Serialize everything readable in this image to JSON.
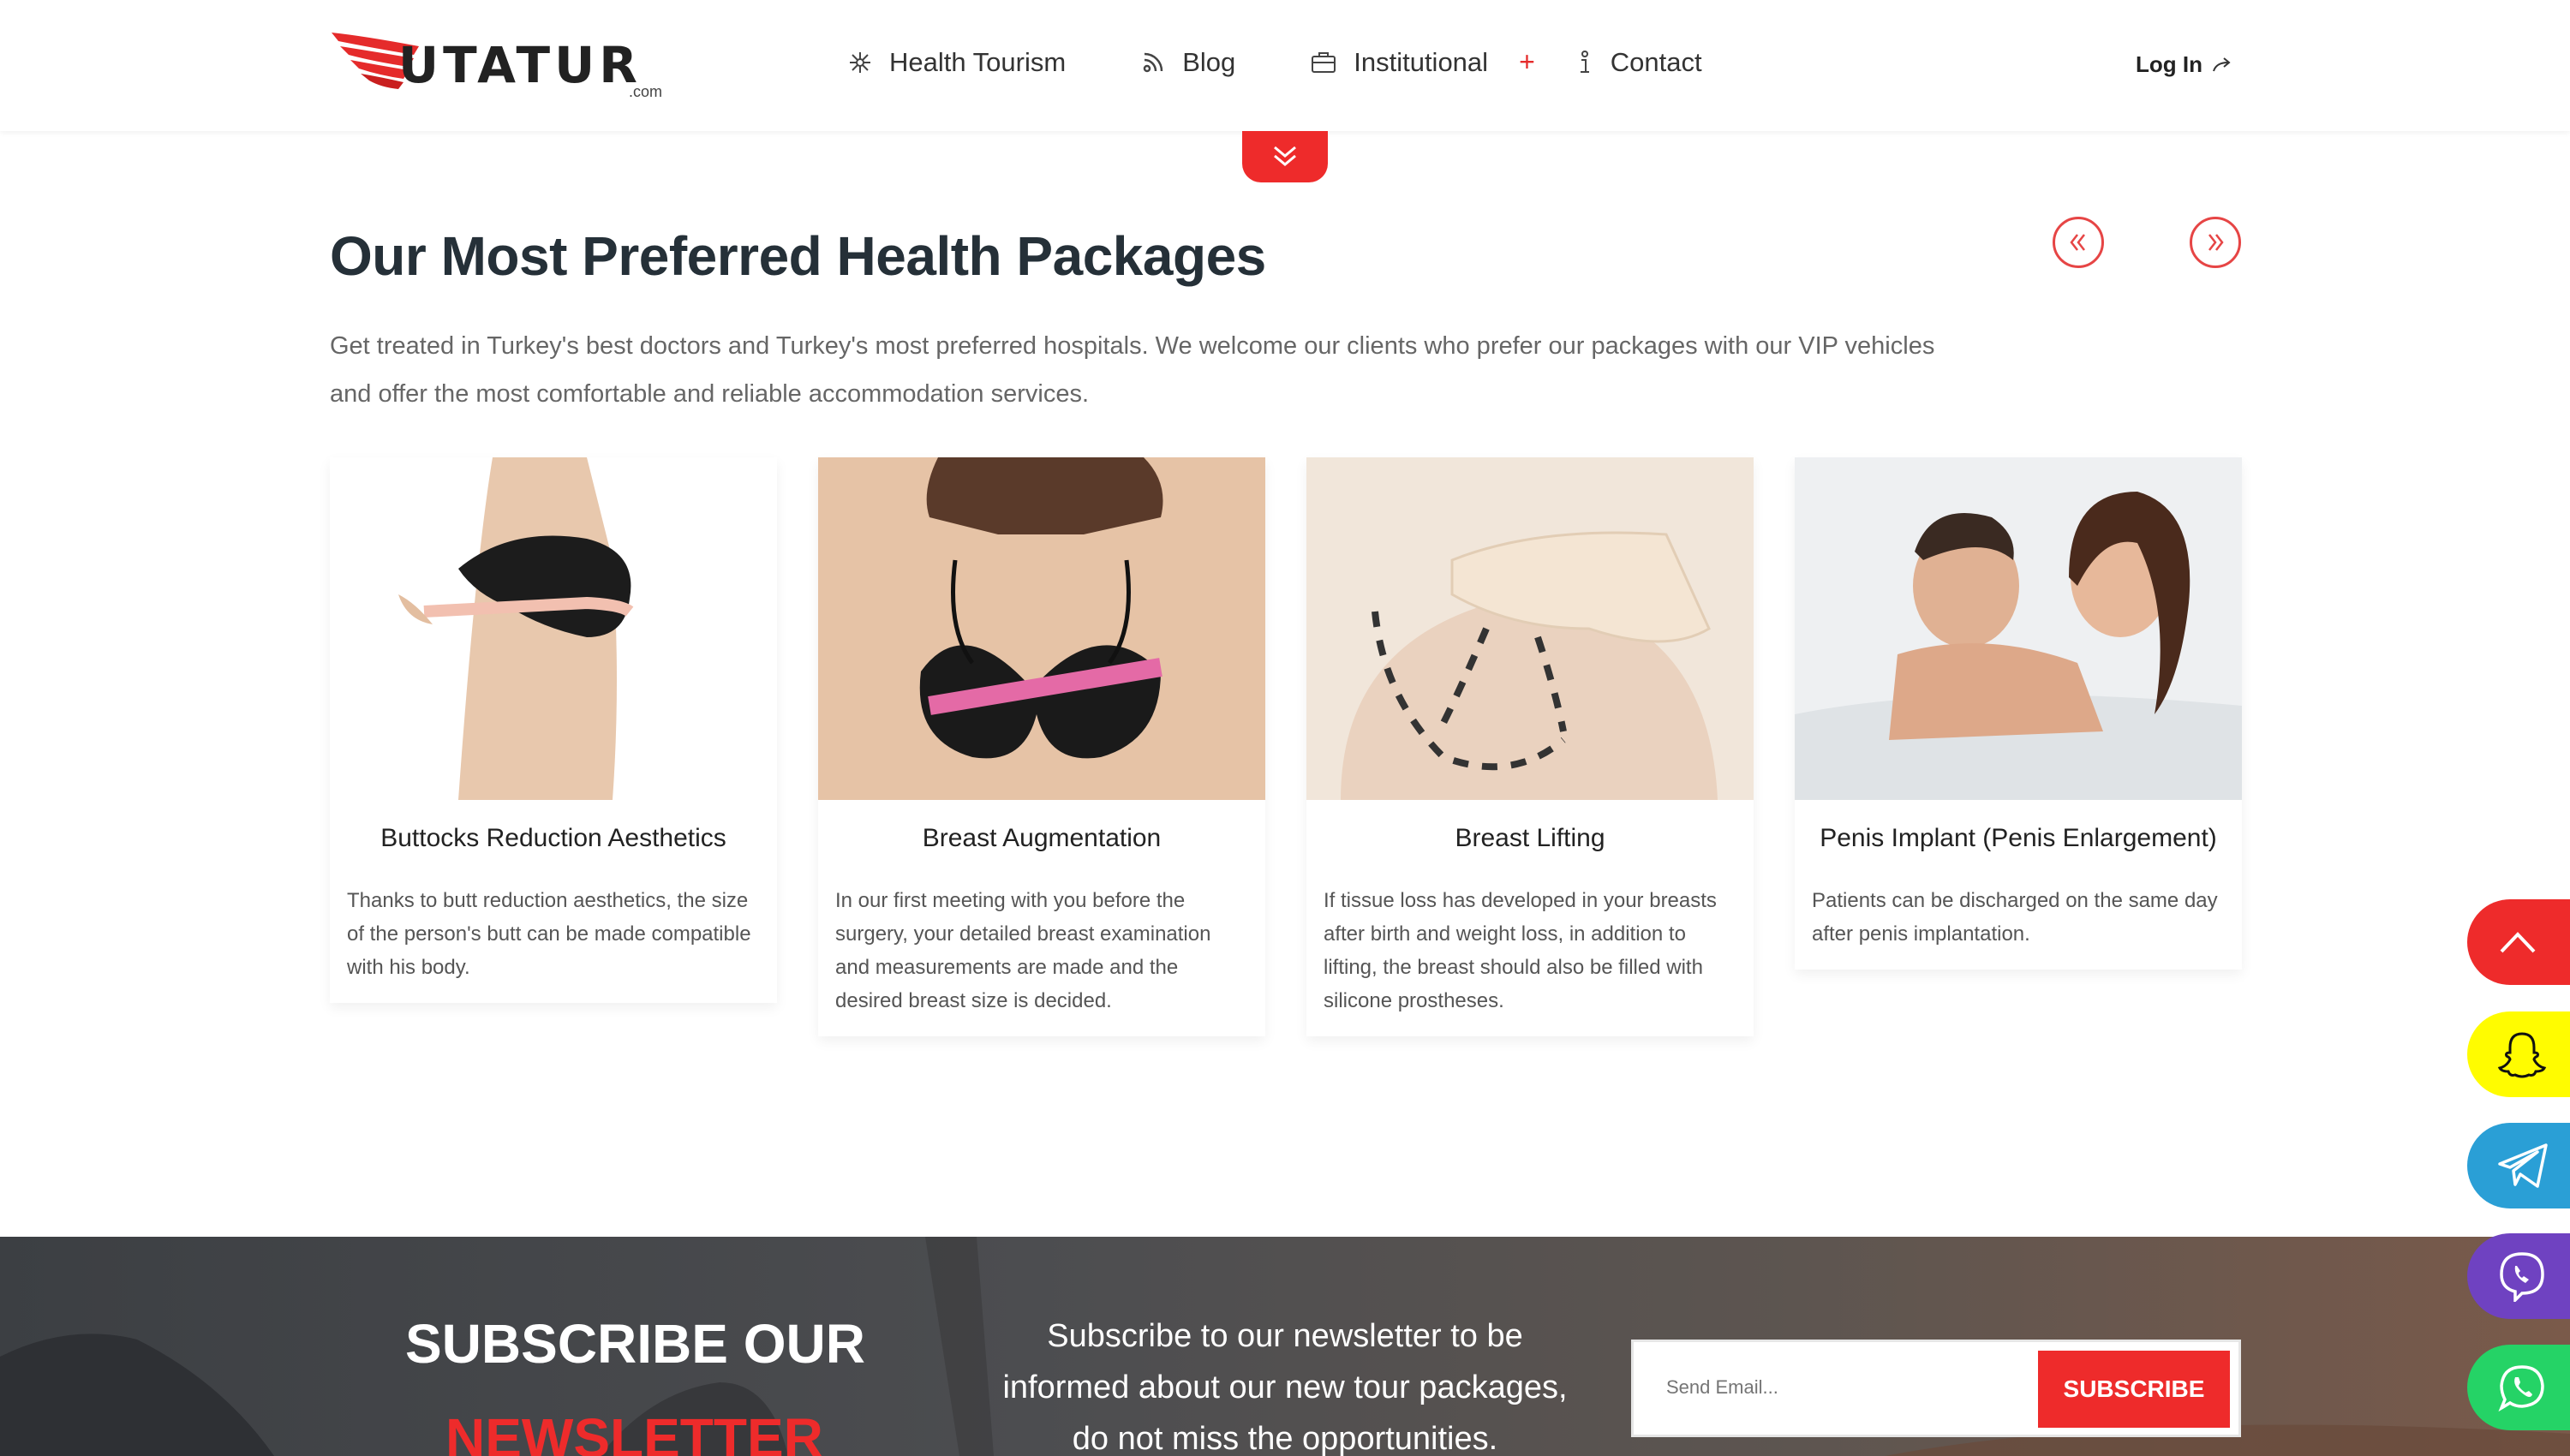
{
  "header": {
    "logo": {
      "text": "UTATUR",
      "sub": ".com"
    },
    "nav": [
      {
        "label": "Health Tourism",
        "icon": "medical-icon"
      },
      {
        "label": "Blog",
        "icon": "rss-icon"
      },
      {
        "label": "Institutional",
        "icon": "briefcase-icon",
        "plus": "+"
      },
      {
        "label": "Contact",
        "icon": "info-icon"
      }
    ],
    "login": "Log In"
  },
  "section": {
    "title": "Our Most Preferred Health Packages",
    "description": "Get treated in Turkey's best doctors and Turkey's most preferred hospitals. We welcome our clients who prefer our packages with our VIP vehicles and offer the most comfortable and reliable accommodation services."
  },
  "cards": [
    {
      "title": "Buttocks Reduction Aesthetics",
      "text": "Thanks to butt reduction aesthetics, the size of the person's butt can be made compatible with his body."
    },
    {
      "title": "Breast Augmentation",
      "text": "In our first meeting with you before the surgery, your detailed breast examination and measurements are made and the desired breast size is decided."
    },
    {
      "title": "Breast Lifting",
      "text": "If tissue loss has developed in your breasts after birth and weight loss, in addition to lifting, the breast should also be filled with silicone prostheses."
    },
    {
      "title": "Penis Implant (Penis Enlargement)",
      "text": "Patients can be discharged on the same day after penis implantation."
    }
  ],
  "newsletter": {
    "title_line1": "SUBSCRIBE OUR",
    "title_line2": "NEWSLETTER",
    "text": "Subscribe to our newsletter to be informed about our new tour packages, do not miss the opportunities.",
    "placeholder": "Send Email...",
    "button": "SUBSCRIBE"
  },
  "colors": {
    "accent": "#ee2b2b",
    "snapchat": "#fffc00",
    "telegram": "#2a9fd6",
    "viber": "#6f42c1",
    "whatsapp": "#25d366"
  }
}
